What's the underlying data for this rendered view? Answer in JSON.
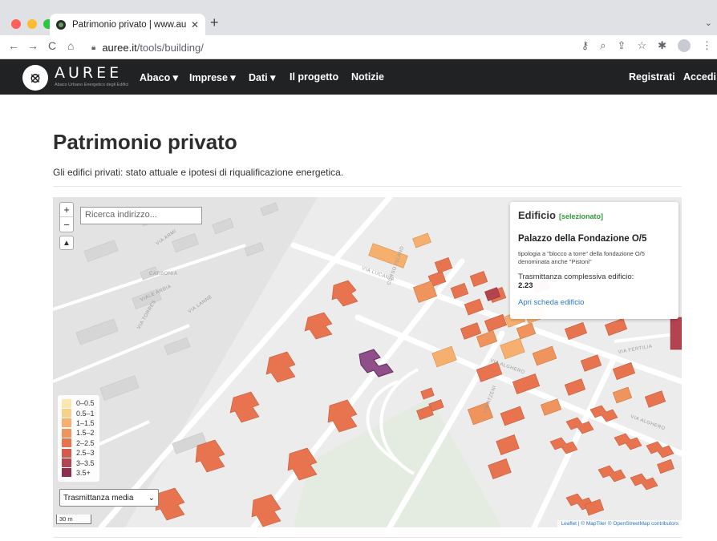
{
  "browser": {
    "tab_title": "Patrimonio privato | www.aureo",
    "tab_close": "✕",
    "new_tab": "+",
    "url_host": "auree.it",
    "url_path": "/tools/building/",
    "nav_back": "←",
    "nav_forward": "→",
    "nav_reload": "C",
    "nav_home": "⌂"
  },
  "site": {
    "logo_text": "AUREE",
    "logo_subtitle": "Abaco Urbano Energetico degli Edifici",
    "menu": [
      {
        "label": "Abaco ▾"
      },
      {
        "label": "Imprese ▾"
      },
      {
        "label": "Dati ▾"
      },
      {
        "label": "Il progetto"
      },
      {
        "label": "Notizie"
      }
    ],
    "right_menu": [
      {
        "label": "Registrati"
      },
      {
        "label": "Accedi"
      }
    ]
  },
  "page": {
    "title": "Patrimonio privato",
    "subtitle": "Gli edifici privati: stato attuale e ipotesi di riqualificazione energetica."
  },
  "map": {
    "search_placeholder": "Ricerca indirizzo...",
    "zoom_in": "+",
    "zoom_out": "−",
    "compass": "▲",
    "popup": {
      "title": "Edificio",
      "selected_badge": "[selezionato]",
      "building_name": "Palazzo della Fondazione O/5",
      "description": "tipologia a \"blocco a torre\" della fondazione O/5 denominata anche \"Pistoni\"",
      "transmittance_label": "Trasmittanza complessiva edificio:",
      "transmittance_value": "2.23",
      "link": "Apri scheda edificio"
    },
    "legend": [
      {
        "label": "0–0.5",
        "color": "#fde7b0"
      },
      {
        "label": "0.5–1",
        "color": "#f9cf8a"
      },
      {
        "label": "1–1.5",
        "color": "#f5b070"
      },
      {
        "label": "1.5–2",
        "color": "#f0945d"
      },
      {
        "label": "2–2.5",
        "color": "#e7744f"
      },
      {
        "label": "2.5–3",
        "color": "#d55a4c"
      },
      {
        "label": "3–3.5",
        "color": "#b3444f"
      },
      {
        "label": "3.5+",
        "color": "#8e2f4f"
      }
    ],
    "select_value": "Trasmittanza media",
    "scale_label": "30 m",
    "attribution_prefix": "Leaflet | ",
    "attribution_links": "© MapTiler © OpenStreetMap contributors",
    "street_labels": [
      "VIA LUCANIA",
      "CORSO ISLAND",
      "VIA ALGHERO",
      "VIA ALGHERO",
      "VIA FERTILIA",
      "VIA ATZENI",
      "CARBONIA",
      "VIA ARMI",
      "VIALE ARBIA",
      "VIA TORRES",
      "VIA LANNE"
    ],
    "colors": {
      "selected": "#8e4f8a",
      "accent": "#e7744f"
    }
  }
}
